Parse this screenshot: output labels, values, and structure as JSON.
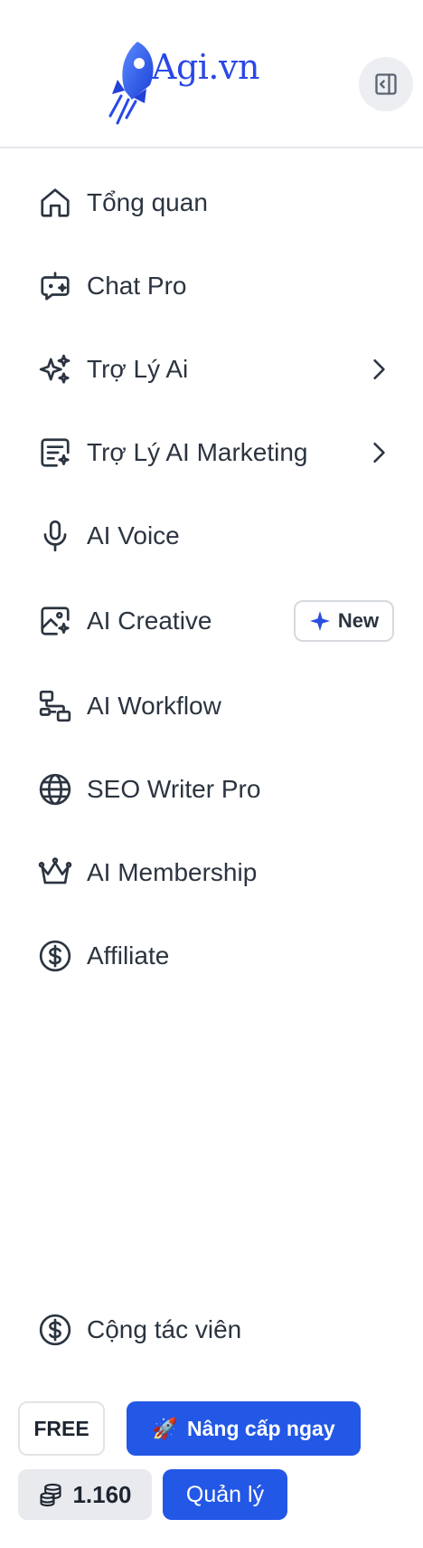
{
  "brand": {
    "name": "Agi.vn",
    "accent": "#2357e6"
  },
  "header": {
    "collapse_icon": "sidebar-collapse-icon"
  },
  "nav": {
    "items": [
      {
        "label": "Tổng quan",
        "icon": "home-icon"
      },
      {
        "label": "Chat Pro",
        "icon": "chat-bot-icon"
      },
      {
        "label": "Trợ Lý Ai",
        "icon": "sparkles-icon",
        "has_submenu": true
      },
      {
        "label": "Trợ Lý AI Marketing",
        "icon": "document-sparkle-icon",
        "has_submenu": true
      },
      {
        "label": "AI Voice",
        "icon": "microphone-icon"
      },
      {
        "label": "AI Creative",
        "icon": "image-sparkle-icon",
        "badge": "New"
      },
      {
        "label": "AI Workflow",
        "icon": "workflow-icon"
      },
      {
        "label": "SEO Writer Pro",
        "icon": "globe-icon"
      },
      {
        "label": "AI Membership",
        "icon": "crown-icon"
      },
      {
        "label": "Affiliate",
        "icon": "dollar-circle-icon"
      }
    ],
    "bottom_item": {
      "label": "Cộng tác viên",
      "icon": "dollar-circle-icon"
    }
  },
  "footer": {
    "plan": "FREE",
    "upgrade_label": "Nâng cấp ngay",
    "upgrade_icon": "🚀",
    "credits": "1.160",
    "manage_label": "Quản lý"
  }
}
